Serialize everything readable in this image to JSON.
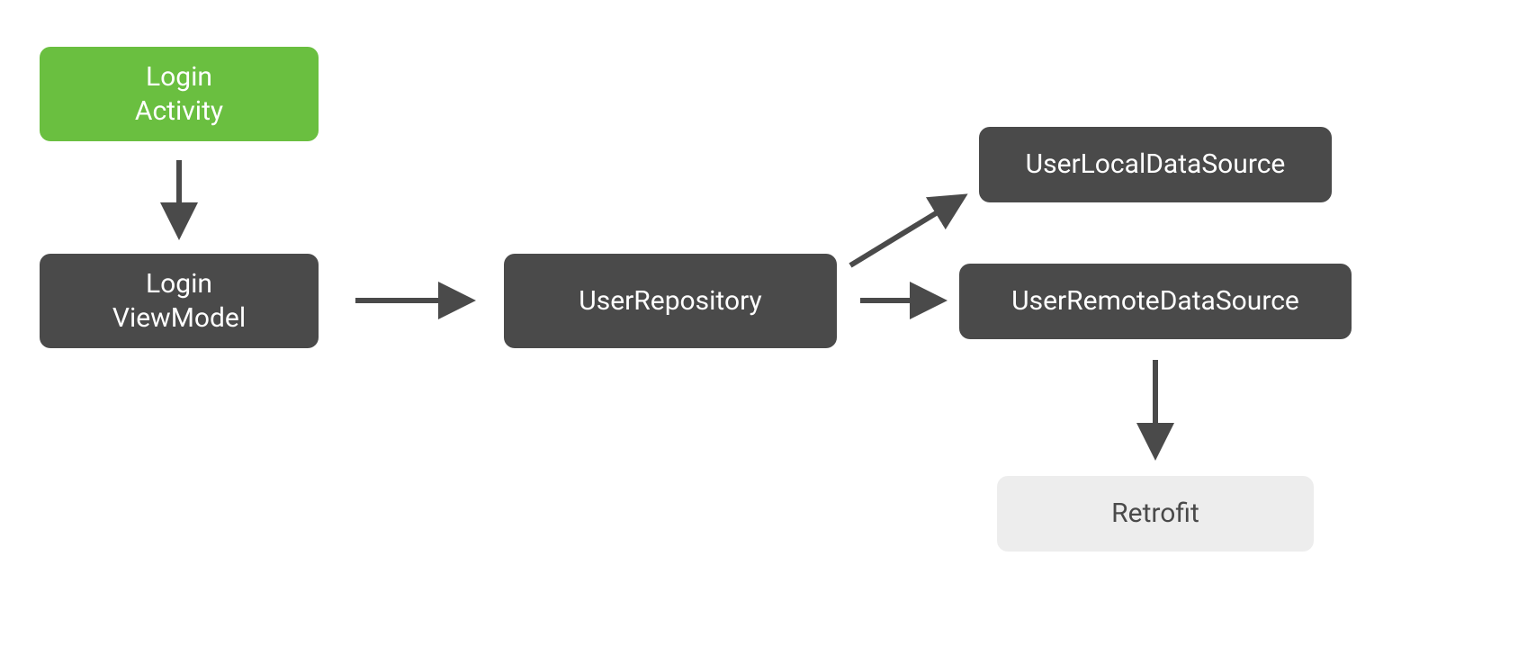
{
  "nodes": {
    "login_activity": {
      "line1": "Login",
      "line2": "Activity"
    },
    "login_viewmodel": {
      "line1": "Login",
      "line2": "ViewModel"
    },
    "user_repository": {
      "label": "UserRepository"
    },
    "user_local_ds": {
      "label": "UserLocalDataSource"
    },
    "user_remote_ds": {
      "label": "UserRemoteDataSource"
    },
    "retrofit": {
      "label": "Retrofit"
    }
  },
  "colors": {
    "green": "#6ABF40",
    "dark": "#4A4A4A",
    "light": "#EDEDED",
    "arrow": "#4A4A4A"
  },
  "diagram": {
    "type": "dependency-graph",
    "edges": [
      [
        "login_activity",
        "login_viewmodel"
      ],
      [
        "login_viewmodel",
        "user_repository"
      ],
      [
        "user_repository",
        "user_local_ds"
      ],
      [
        "user_repository",
        "user_remote_ds"
      ],
      [
        "user_remote_ds",
        "retrofit"
      ]
    ]
  }
}
